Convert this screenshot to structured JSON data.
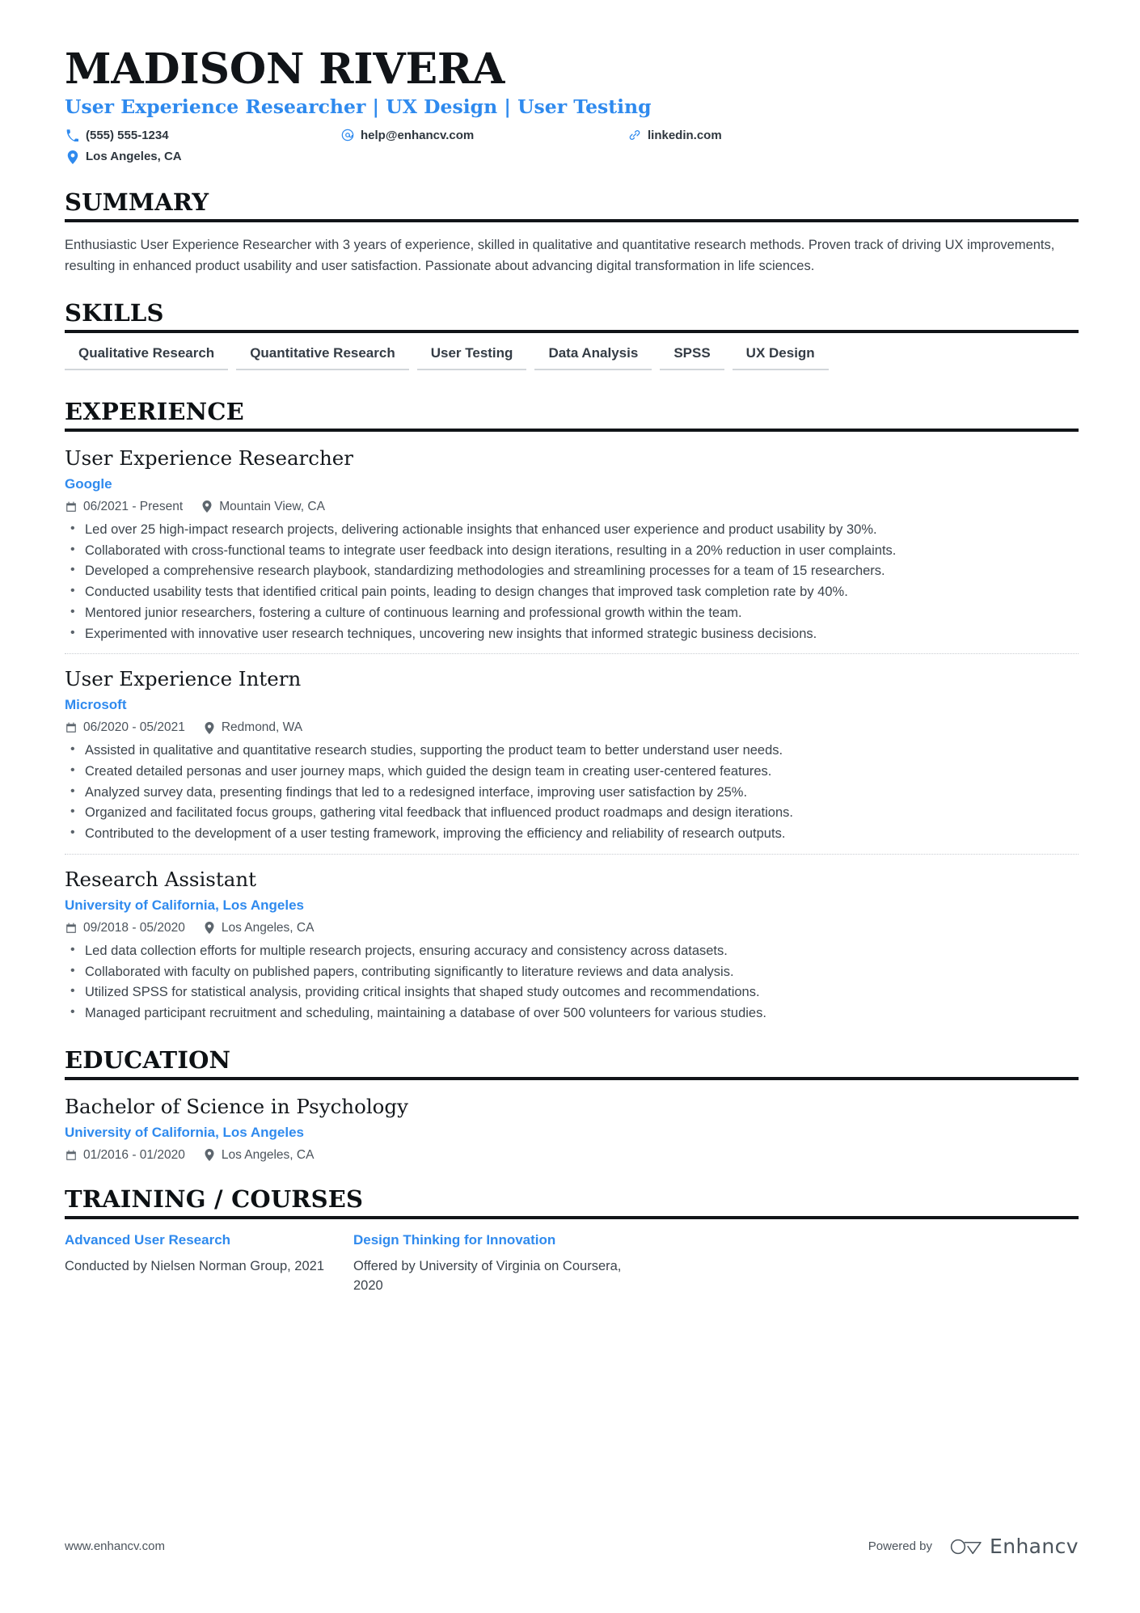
{
  "colors": {
    "accent": "#2f8aee",
    "ink": "#111418",
    "body": "#3c444c",
    "rule": "#111418",
    "skill_underline": "#d2d6da"
  },
  "header": {
    "name": "MADISON RIVERA",
    "headline": "User Experience Researcher | UX Design | User Testing",
    "contacts": [
      {
        "icon": "phone-icon",
        "text": "(555) 555-1234"
      },
      {
        "icon": "email-icon",
        "text": "help@enhancv.com"
      },
      {
        "icon": "link-icon",
        "text": "linkedin.com"
      },
      {
        "icon": "location-icon",
        "text": "Los Angeles, CA"
      }
    ]
  },
  "summary": {
    "title": "SUMMARY",
    "text": "Enthusiastic User Experience Researcher with 3 years of experience, skilled in qualitative and quantitative research methods. Proven track of driving UX improvements, resulting in enhanced product usability and user satisfaction. Passionate about advancing digital transformation in life sciences."
  },
  "skills": {
    "title": "SKILLS",
    "items": [
      "Qualitative Research",
      "Quantitative Research",
      "User Testing",
      "Data Analysis",
      "SPSS",
      "UX Design"
    ]
  },
  "experience": {
    "title": "EXPERIENCE",
    "entries": [
      {
        "role": "User Experience Researcher",
        "organization": "Google",
        "dates": "06/2021 - Present",
        "location": "Mountain View, CA",
        "bullets": [
          "Led over 25 high-impact research projects, delivering actionable insights that enhanced user experience and product usability by 30%.",
          "Collaborated with cross-functional teams to integrate user feedback into design iterations, resulting in a 20% reduction in user complaints.",
          "Developed a comprehensive research playbook, standardizing methodologies and streamlining processes for a team of 15 researchers.",
          "Conducted usability tests that identified critical pain points, leading to design changes that improved task completion rate by 40%.",
          "Mentored junior researchers, fostering a culture of continuous learning and professional growth within the team.",
          "Experimented with innovative user research techniques, uncovering new insights that informed strategic business decisions."
        ]
      },
      {
        "role": "User Experience Intern",
        "organization": "Microsoft",
        "dates": "06/2020 - 05/2021",
        "location": "Redmond, WA",
        "bullets": [
          "Assisted in qualitative and quantitative research studies, supporting the product team to better understand user needs.",
          "Created detailed personas and user journey maps, which guided the design team in creating user-centered features.",
          "Analyzed survey data, presenting findings that led to a redesigned interface, improving user satisfaction by 25%.",
          "Organized and facilitated focus groups, gathering vital feedback that influenced product roadmaps and design iterations.",
          "Contributed to the development of a user testing framework, improving the efficiency and reliability of research outputs."
        ]
      },
      {
        "role": "Research Assistant",
        "organization": "University of California, Los Angeles",
        "dates": "09/2018 - 05/2020",
        "location": "Los Angeles, CA",
        "bullets": [
          "Led data collection efforts for multiple research projects, ensuring accuracy and consistency across datasets.",
          "Collaborated with faculty on published papers, contributing significantly to literature reviews and data analysis.",
          "Utilized SPSS for statistical analysis, providing critical insights that shaped study outcomes and recommendations.",
          "Managed participant recruitment and scheduling, maintaining a database of over 500 volunteers for various studies."
        ]
      }
    ]
  },
  "education": {
    "title": "EDUCATION",
    "entries": [
      {
        "degree": "Bachelor of Science in Psychology",
        "organization": "University of California, Los Angeles",
        "dates": "01/2016 - 01/2020",
        "location": "Los Angeles, CA"
      }
    ]
  },
  "courses": {
    "title": "TRAINING / COURSES",
    "items": [
      {
        "name": "Advanced User Research",
        "description": "Conducted by Nielsen Norman Group, 2021"
      },
      {
        "name": "Design Thinking for Innovation",
        "description": "Offered by University of Virginia on Coursera, 2020"
      }
    ]
  },
  "footer": {
    "url": "www.enhancv.com",
    "powered_by": "Powered by",
    "brand": "Enhancv"
  }
}
